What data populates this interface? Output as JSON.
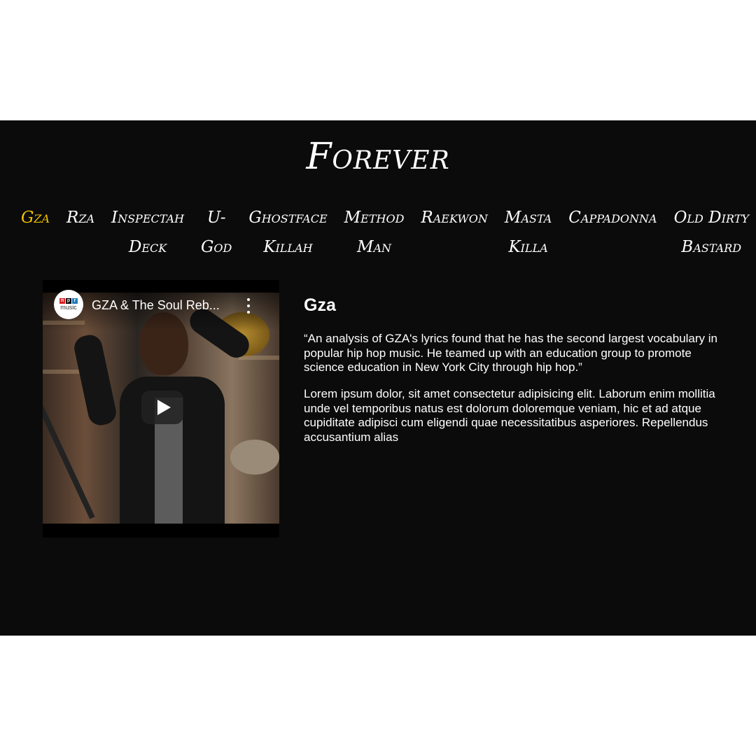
{
  "header": {
    "title": "Forever"
  },
  "nav": {
    "items": [
      {
        "label": "Gza",
        "active": true
      },
      {
        "label": "Rza"
      },
      {
        "label": "Inspectah\nDeck"
      },
      {
        "label": "U-\nGod"
      },
      {
        "label": "Ghostface\nKillah"
      },
      {
        "label": "Method\nMan"
      },
      {
        "label": "Raekwon"
      },
      {
        "label": "Masta\nKilla"
      },
      {
        "label": "Cappadonna"
      },
      {
        "label": "Old Dirty\nBastard"
      }
    ],
    "active_color": "#f2c300"
  },
  "video": {
    "channel": {
      "npr": [
        "n",
        "p",
        "r"
      ],
      "music": "music"
    },
    "title": "GZA & The Soul Reb...",
    "icons": {
      "menu": "more-vert-icon",
      "play": "play-icon"
    }
  },
  "member": {
    "name": "Gza",
    "quote": "“An analysis of GZA's lyrics found that he has the second largest vocabulary in popular hip hop music. He teamed up with an education group to promote science education in New York City through hip hop.”",
    "body": "Lorem ipsum dolor, sit amet consectetur adipisicing elit. Laborum enim mollitia unde vel temporibus natus est dolorum doloremque veniam, hic et ad atque cupiditate adipisci cum eligendi quae necessitatibus asperiores. Repellendus accusantium alias"
  }
}
